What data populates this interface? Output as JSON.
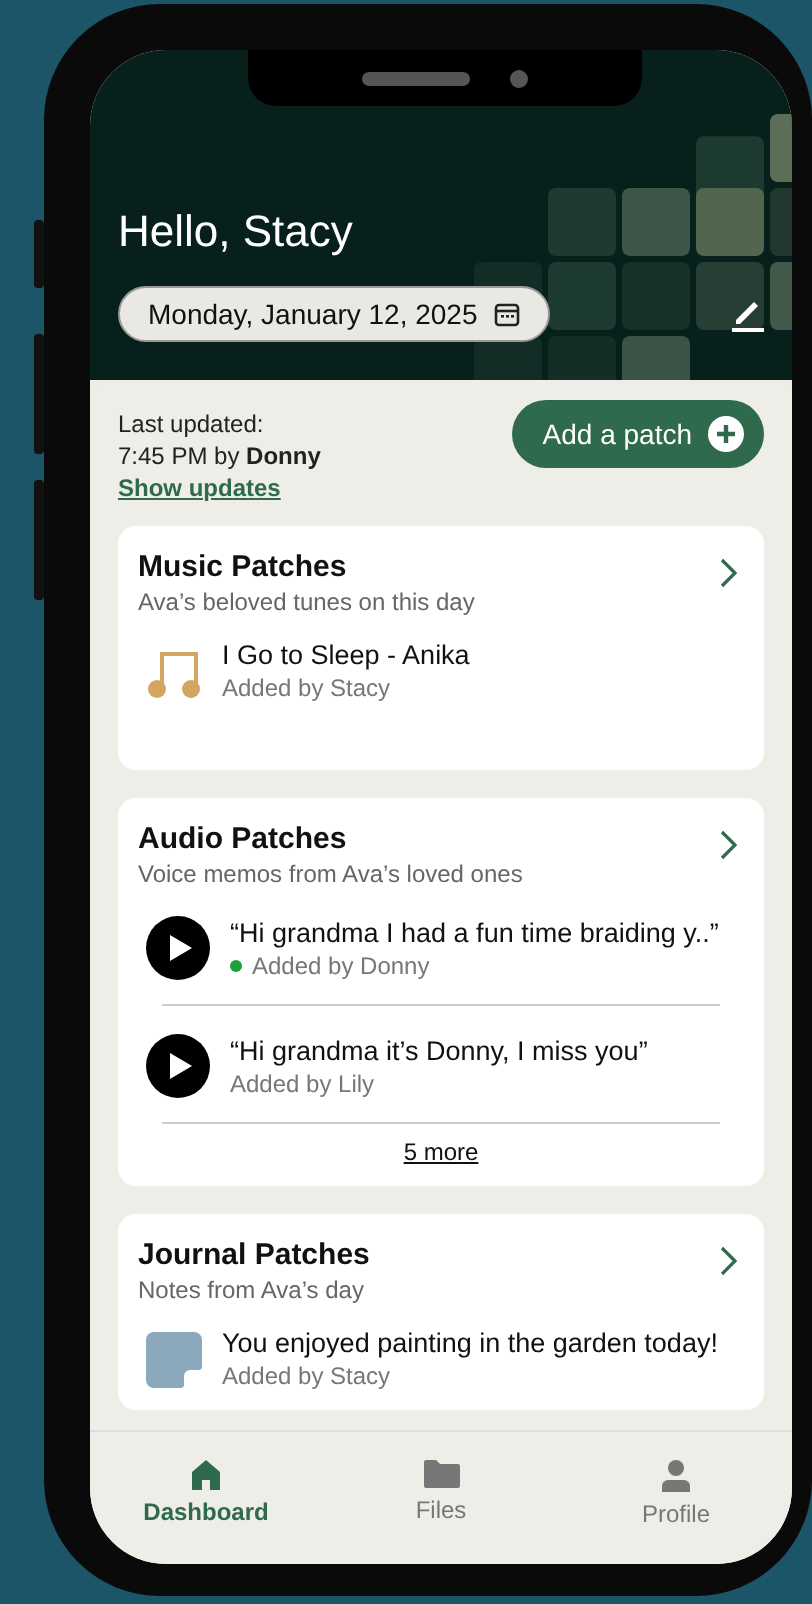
{
  "header": {
    "greeting": "Hello, Stacy",
    "date": "Monday, January 12, 2025"
  },
  "update": {
    "label": "Last updated:",
    "time": "7:45 PM by **Donny**",
    "link": "Show updates",
    "button": "Add a patch"
  },
  "sections": [
    {
      "title": "Music Patches",
      "subtitle": "Ava’s beloved tunes on this day",
      "kind": "music",
      "items": [
        {
          "title": "I Go to Sleep - Anika",
          "author": "Added by Stacy",
          "new": false
        }
      ]
    },
    {
      "title": "Audio Patches",
      "subtitle": "Voice memos from Ava’s loved ones",
      "kind": "audio",
      "items": [
        {
          "title": "“Hi grandma I had a fun time braiding y..”",
          "author": "Added by Donny",
          "new": true
        },
        {
          "title": "“Hi grandma it’s Donny, I miss you”",
          "author": "Added by Lily",
          "new": false
        }
      ],
      "more": "5 more"
    },
    {
      "title": "Journal Patches",
      "subtitle": "Notes from Ava’s day",
      "kind": "journal",
      "items": [
        {
          "title": "You enjoyed painting in the garden today!",
          "author": "Added by Stacy",
          "new": false
        }
      ]
    }
  ],
  "nav": [
    {
      "label": "Dashboard",
      "kind": "home",
      "selected": true
    },
    {
      "label": "Files",
      "kind": "folder",
      "selected": false
    },
    {
      "label": "Profile",
      "kind": "person",
      "selected": false
    }
  ]
}
